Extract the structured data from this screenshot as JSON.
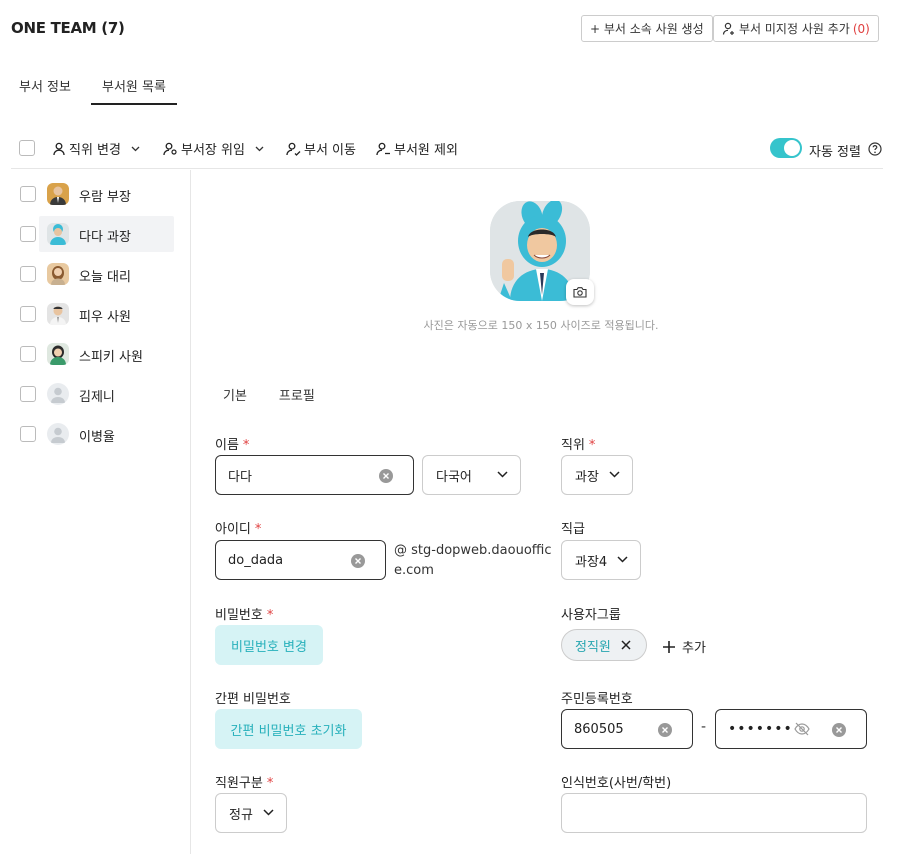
{
  "header": {
    "title": "ONE TEAM (7)",
    "create_button": "+ 부서 소속 사원 생성",
    "add_button": "부서 미지정 사원 추가",
    "add_button_count": "(0)"
  },
  "tabs": [
    "부서 정보",
    "부서원 목록"
  ],
  "toolbar": {
    "change_position": "직위 변경",
    "delegate_head": "부서장 위임",
    "move_dept": "부서 이동",
    "remove_member": "부서원 제외",
    "auto_sort_label": "자동 정렬",
    "auto_sort_on": true
  },
  "members": [
    {
      "name": "우람 부장",
      "avatar": "photo-man-suit"
    },
    {
      "name": "다다 과장",
      "avatar": "photo-man-blue-hood",
      "selected": true
    },
    {
      "name": "오늘 대리",
      "avatar": "photo-woman"
    },
    {
      "name": "피우 사원",
      "avatar": "photo-man-shirt"
    },
    {
      "name": "스피키 사원",
      "avatar": "photo-woman-green"
    },
    {
      "name": "김제니",
      "avatar": "default-avatar"
    },
    {
      "name": "이병율",
      "avatar": "default-avatar"
    }
  ],
  "profile": {
    "photo_note": "사진은 자동으로 150 x 150 사이즈로 적용됩니다.",
    "subtabs": [
      "기본",
      "프로필"
    ]
  },
  "form": {
    "name_label": "이름",
    "name_value": "다다",
    "language_value": "다국어",
    "position_label": "직위",
    "position_value": "과장",
    "id_label": "아이디",
    "id_value": "do_dada",
    "id_domain": "@ stg-dopweb.daouoffice.com",
    "rank_label": "직급",
    "rank_value": "과장4",
    "password_label": "비밀번호",
    "password_button": "비밀번호 변경",
    "group_label": "사용자그룹",
    "group_chip": "정직원",
    "group_add": "추가",
    "simple_pw_label": "간편 비밀번호",
    "simple_pw_button": "간편 비밀번호 초기화",
    "rrn_label": "주민등록번호",
    "rrn_front": "860505",
    "rrn_separator": "-",
    "rrn_back": "•••••••",
    "emp_type_label": "직원구분",
    "emp_type_value": "정규",
    "emp_no_label": "인식번호(사번/학번)",
    "emp_no_value": "",
    "required_mark": "*"
  },
  "colors": {
    "accent": "#35c4cc",
    "accent_text": "#27b0bb",
    "accent_bg": "#d6f3f5",
    "required": "#e04040"
  }
}
